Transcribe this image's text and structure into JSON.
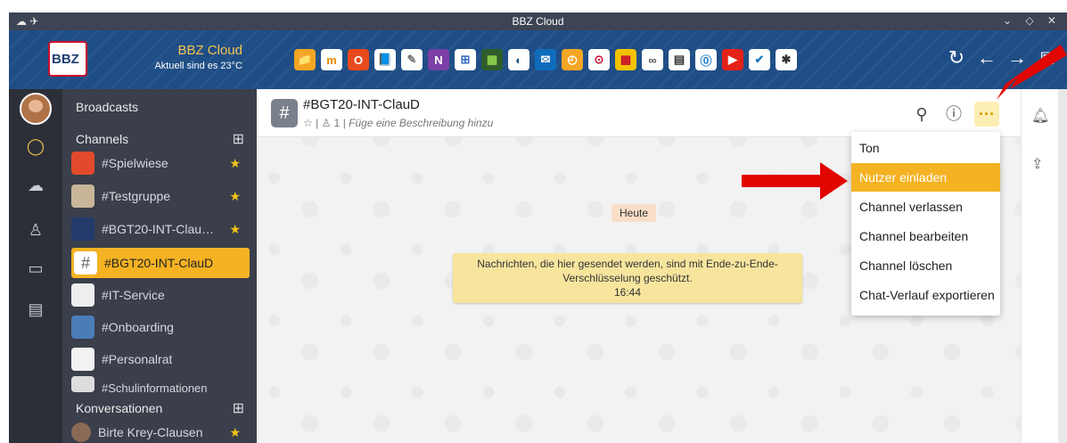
{
  "window": {
    "title": "BBZ Cloud",
    "controls": "⌄ ◇ ✕",
    "left_icons": "☁ ✈"
  },
  "header": {
    "logo_text": "BBZ",
    "brand": "BBZ Cloud",
    "weather": "Aktuell sind es 23°C",
    "apps": [
      "📁",
      "m",
      "O",
      "📘",
      "✎",
      "N",
      "⊞",
      "▦",
      "◐",
      "✉",
      "◴",
      "⊙",
      "▩",
      "∞",
      "▤",
      "⓪",
      "▶",
      "✔",
      "✱"
    ],
    "nav": [
      "↻",
      "←",
      "→",
      "⧉"
    ]
  },
  "rail": {
    "icons": [
      "chat-icon",
      "cloud-icon",
      "person-icon",
      "calendar-icon",
      "clipboard-icon"
    ]
  },
  "sidebar": {
    "broadcasts": "Broadcasts",
    "channels_heading": "Channels",
    "channels": [
      {
        "label": "#Spielwiese",
        "starred": true,
        "color": "#e24a2b"
      },
      {
        "label": "#Testgruppe",
        "starred": true,
        "color": "#c9b69a"
      },
      {
        "label": "#BGT20-INT-ClauD…",
        "starred": true,
        "color": "#243a6b"
      },
      {
        "label": "#BGT20-INT-ClauD",
        "starred": false,
        "selected": true
      },
      {
        "label": "#IT-Service",
        "starred": false,
        "color": "#eeeeee"
      },
      {
        "label": "#Onboarding",
        "starred": false,
        "color": "#4a7db8"
      },
      {
        "label": "#Personalrat",
        "starred": false,
        "color": "#f2f2f2"
      },
      {
        "label": "#Schulinformationen",
        "starred": false,
        "color": "#dddddd"
      }
    ],
    "conversations_heading": "Konversationen",
    "conversations": [
      {
        "label": "Birte Krey-Clausen",
        "starred": true
      }
    ]
  },
  "chat": {
    "title": "#BGT20-INT-ClauD",
    "member_count": "1",
    "description": "Füge eine Beschreibung hinzu",
    "date": "Heute",
    "system_message_line1": "Nachrichten, die hier gesendet werden, sind mit Ende-zu-Ende-",
    "system_message_line2": "Verschlüsselung geschützt.",
    "system_message_time": "16:44"
  },
  "menu": {
    "items": [
      "Ton",
      "Nutzer einladen",
      "Channel verlassen",
      "Channel bearbeiten",
      "Channel löschen",
      "Chat-Verlauf exportieren"
    ],
    "highlighted_index": 1
  },
  "colors": {
    "accent": "#f5b223",
    "header": "#1f4e86",
    "annotation_arrow": "#e10600"
  }
}
